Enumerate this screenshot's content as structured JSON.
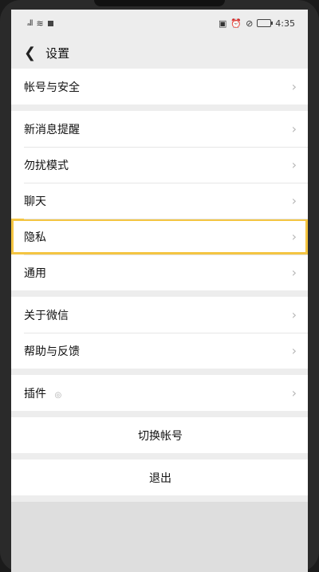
{
  "status": {
    "left_signal": "ₐll",
    "left_wifi": "≋",
    "time": "4:35"
  },
  "header": {
    "title": "设置"
  },
  "groups": [
    {
      "items": [
        {
          "label": "帐号与安全"
        }
      ]
    },
    {
      "items": [
        {
          "label": "新消息提醒"
        },
        {
          "label": "勿扰模式"
        },
        {
          "label": "聊天"
        },
        {
          "label": "隐私"
        },
        {
          "label": "通用"
        }
      ]
    },
    {
      "items": [
        {
          "label": "关于微信"
        },
        {
          "label": "帮助与反馈"
        }
      ]
    },
    {
      "items": [
        {
          "label": "插件"
        }
      ]
    }
  ],
  "actions": {
    "switch_account": "切换帐号",
    "logout": "退出"
  },
  "colors": {
    "highlight": "#f4c542",
    "background": "#ededed"
  }
}
